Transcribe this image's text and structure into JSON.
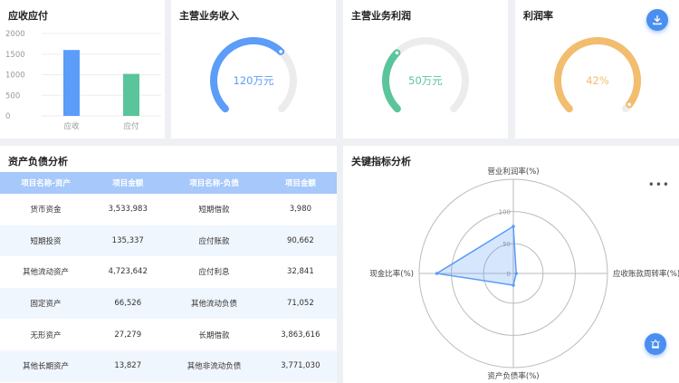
{
  "receivable": {
    "title": "应收应付",
    "chart_data": {
      "type": "bar",
      "categories": [
        "应收",
        "应付"
      ],
      "values": [
        1600,
        1020
      ],
      "ylim": [
        0,
        2000
      ],
      "yticks": [
        "2000",
        "1500",
        "1000",
        "500",
        "0"
      ],
      "colors": [
        "#5b9df8",
        "#5ac59a"
      ]
    }
  },
  "gauges": [
    {
      "title": "主营业务收入",
      "value_text": "120万元",
      "fraction": 0.66,
      "color": "#5b9df8"
    },
    {
      "title": "主营业务利润",
      "value_text": "50万元",
      "fraction": 0.33,
      "color": "#5ac59a"
    },
    {
      "title": "利润率",
      "value_text": "42%",
      "fraction": 0.97,
      "color": "#f2bd6d"
    }
  ],
  "balance": {
    "title": "资产负债分析",
    "headers": [
      "项目名称-资产",
      "项目金额",
      "项目名称-负债",
      "项目金额"
    ],
    "rows": [
      [
        "货币资金",
        "3,533,983",
        "短期借款",
        "3,980"
      ],
      [
        "短期投资",
        "135,337",
        "应付账款",
        "90,662"
      ],
      [
        "其他流动资产",
        "4,723,642",
        "应付利息",
        "32,841"
      ],
      [
        "固定资产",
        "66,526",
        "其他流动负债",
        "71,052"
      ],
      [
        "无形资产",
        "27,279",
        "长期借款",
        "3,863,616"
      ],
      [
        "其他长期资产",
        "13,827",
        "其他非流动负债",
        "3,771,030"
      ]
    ]
  },
  "radar": {
    "title": "关键指标分析",
    "more": "•••",
    "chart_data": {
      "type": "radar",
      "indicators": [
        "营业利润率(%)",
        "应收账款周转率(%)",
        "资产负债率(%)",
        "现金比率(%)"
      ],
      "values": [
        80,
        5,
        20,
        130
      ],
      "max": 160,
      "ring_labels": [
        "100",
        "50",
        "0"
      ],
      "color": "#5b9df8"
    }
  },
  "icons": {
    "download": "download-icon",
    "alarm": "alarm-icon"
  }
}
